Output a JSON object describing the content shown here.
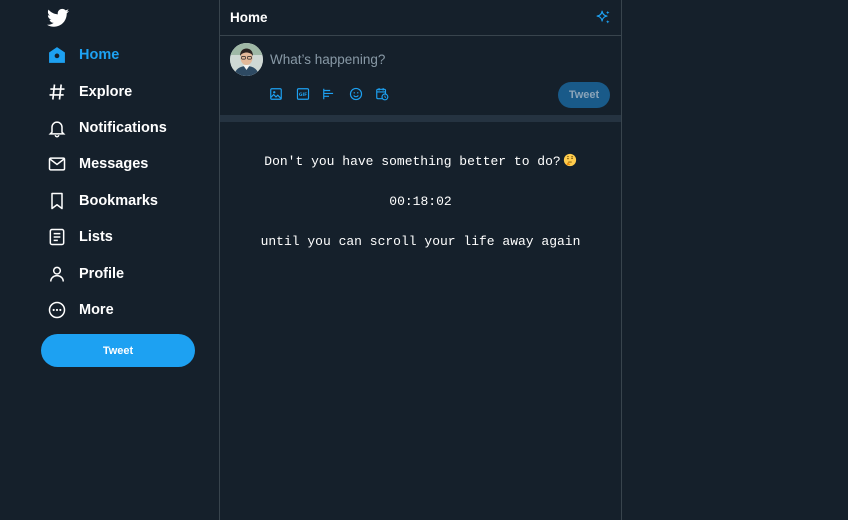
{
  "colors": {
    "background": "#15202b",
    "accent": "#1da1f2",
    "border": "#38444d",
    "muted": "#8899a6",
    "disabled_button": "#195a89"
  },
  "logo_icon": "twitter-bird-icon",
  "nav": {
    "items": [
      {
        "label": "Home",
        "icon": "home-icon",
        "active": true
      },
      {
        "label": "Explore",
        "icon": "hashtag-icon"
      },
      {
        "label": "Notifications",
        "icon": "bell-icon"
      },
      {
        "label": "Messages",
        "icon": "envelope-icon"
      },
      {
        "label": "Bookmarks",
        "icon": "bookmark-icon"
      },
      {
        "label": "Lists",
        "icon": "list-icon"
      },
      {
        "label": "Profile",
        "icon": "person-icon"
      },
      {
        "label": "More",
        "icon": "more-circle-icon"
      }
    ],
    "tweet_button": "Tweet"
  },
  "main": {
    "title": "Home",
    "header_icon": "sparkle-icon",
    "composer": {
      "placeholder": "What’s happening?",
      "tools": [
        "image-icon",
        "gif-icon",
        "poll-icon",
        "emoji-icon",
        "schedule-icon"
      ],
      "tweet_button": "Tweet"
    },
    "message": {
      "line1": "Don't you have something better to do?",
      "line1_emoji": "thinking-face-icon",
      "timer": "00:18:02",
      "line2": "until you can scroll your life away again"
    }
  }
}
